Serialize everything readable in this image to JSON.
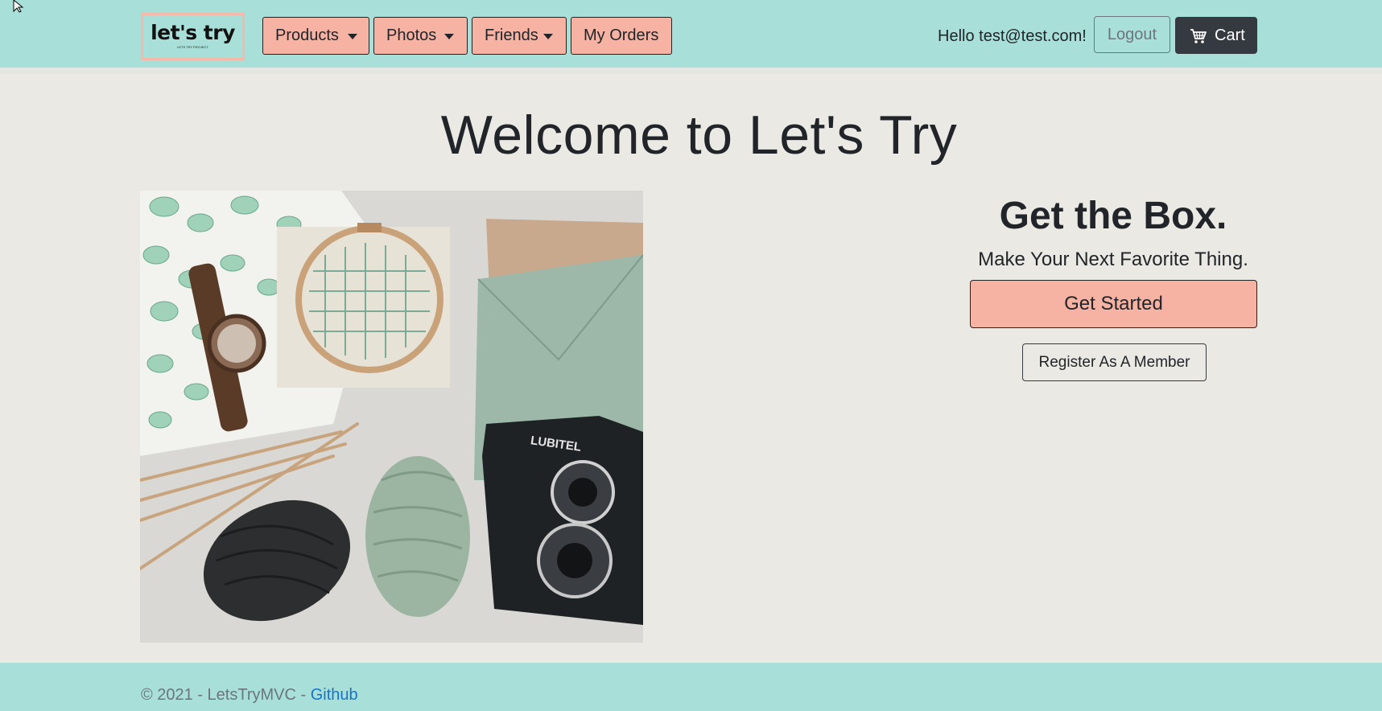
{
  "navbar": {
    "logo_text": "let's try",
    "logo_subtext": "LETS TRY PROJECT",
    "menu": [
      {
        "label": "Products",
        "dropdown": true
      },
      {
        "label": "Photos",
        "dropdown": true
      },
      {
        "label": "Friends",
        "dropdown": true
      },
      {
        "label": "My Orders",
        "dropdown": false
      }
    ],
    "greeting": "Hello test@test.com!",
    "logout_label": "Logout",
    "cart_label": "Cart"
  },
  "main": {
    "heading": "Welcome to Let's Try",
    "cta_title": "Get the Box.",
    "cta_subtitle": "Make Your Next Favorite Thing.",
    "get_started_label": "Get Started",
    "register_label": "Register As A Member",
    "image_alt": "Flat lay of a wooden watch, embroidery hoop, envelopes, knitting needles, yarn and a LUBITEL camera",
    "camera_brand": "LUBITEL"
  },
  "footer": {
    "copyright": "© 2021 - LetsTryMVC - ",
    "link_label": "Github"
  },
  "colors": {
    "navbar_bg": "#a8e0d9",
    "page_bg": "#ebe9e4",
    "accent_button": "#f6b3a3",
    "cart_button": "#343a40",
    "link": "#1a73c8"
  },
  "icons": {
    "cart": "cart-icon",
    "dropdown": "caret-down-icon",
    "cursor": "mouse-pointer-icon"
  }
}
